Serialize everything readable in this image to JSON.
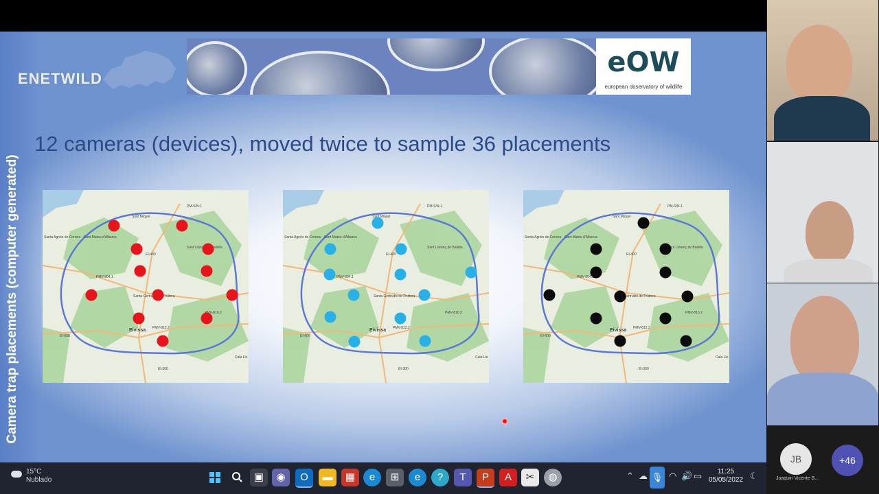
{
  "slide": {
    "vertical_title": "Camera trap placements (computer generated)",
    "logo_enetwild": "ENETWILD",
    "logo_eow": "eOW",
    "logo_eow_subtitle": "european observatory of wildlife",
    "main_title": "12 cameras (devices), moved twice to sample 36 placements",
    "map_labels": {
      "pm": "PM-S/N-1",
      "santa_agnes": "Santa Agnès de Corona",
      "sant_mateu": "Sant Mateu d'Albarca",
      "sant_miquel": "Sant Miquel",
      "e400": "EI-400",
      "pmv804": "PMV-804.1",
      "santa_gertrudis": "Santa Gertrudis de Fruitera",
      "sant_llorenc": "Sant Llorenç de Balàfia",
      "pmv810": "PMV-810.2",
      "eivissa": "Eivissa",
      "pmv812": "PMV-812.2",
      "e600": "EI-600",
      "e300": "EI-300",
      "cala": "Cala Llo"
    },
    "maps": [
      {
        "name": "placement-1",
        "dot_color": "#e8141b"
      },
      {
        "name": "placement-2",
        "dot_color": "#29b0e6"
      },
      {
        "name": "placement-3",
        "dot_color": "#0b0b0b"
      }
    ]
  },
  "taskbar": {
    "weather_temp": "15°C",
    "weather_desc": "Nublado",
    "time": "11:25",
    "date": "05/05/2022"
  },
  "participants": {
    "initials": "JB",
    "name": "Joaquin Vicente B...",
    "more_count": "+46"
  }
}
